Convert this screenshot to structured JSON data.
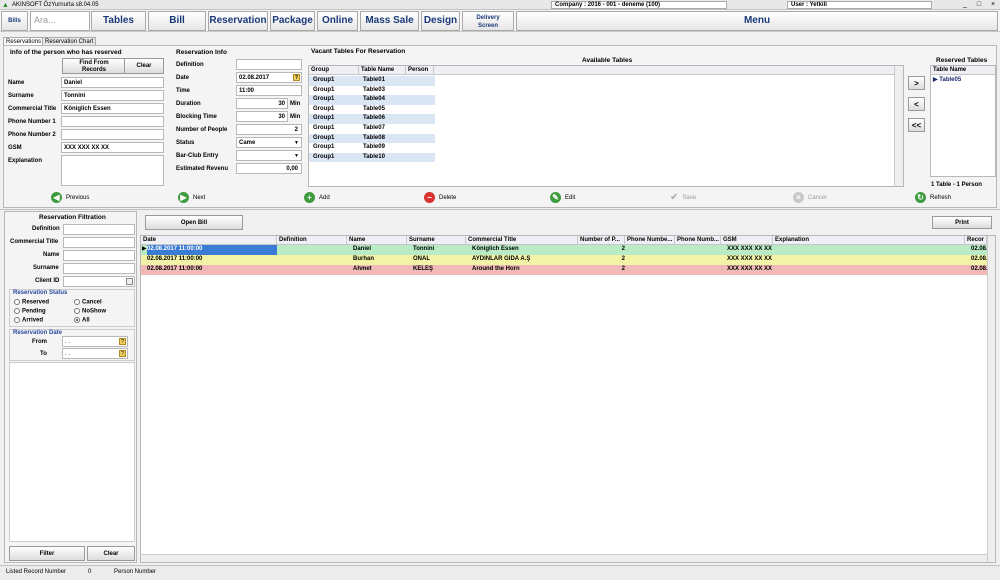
{
  "window": {
    "title": "AKINSOFT ÖzYurnurta  s8.04.05",
    "company": "Company : 2016 - 001 - deneme (100)",
    "user": "User : Yetkili",
    "controls": [
      "_",
      "□",
      "×"
    ]
  },
  "menu": {
    "bills": "Bills",
    "search_placeholder": "Ara...",
    "items": [
      "Tables",
      "Bill",
      "Reservation",
      "Package",
      "Online",
      "Mass Sale",
      "Design"
    ],
    "delivery_line1": "Delivery",
    "delivery_line2": "Screen",
    "menu": "Menu"
  },
  "tabs": [
    "Reservations",
    "Reservation Chart"
  ],
  "person": {
    "title": "Info of the person who has reserved",
    "find_line1": "Find From",
    "find_line2": "Records",
    "clear": "Clear",
    "labels": [
      "Name",
      "Surname",
      "Commercial Title",
      "Phone Number 1",
      "Phone Number 2",
      "GSM",
      "Explanation"
    ],
    "values": [
      "Daniel",
      "Tonnini",
      "Königlich Essen",
      "",
      "",
      "XXX XXX XX XX",
      ""
    ]
  },
  "resinfo": {
    "title": "Reservation Info",
    "labels": [
      "Definition",
      "Date",
      "Time",
      "Duration",
      "Blocking Time",
      "Number of People",
      "Status",
      "Bar-Club Entry",
      "Estimated Revenu"
    ],
    "values": [
      "",
      "02.08.2017",
      "11:00",
      "30",
      "30",
      "2",
      "Came",
      "",
      "0,00"
    ],
    "unit": "Min"
  },
  "vacant": {
    "title": "Vacant Tables For Reservation",
    "available_title": "Available Tables",
    "columns": [
      "Group",
      "Table Name",
      "Person"
    ],
    "rows": [
      [
        "Group1",
        "Table01"
      ],
      [
        "Group1",
        "Table03"
      ],
      [
        "Group1",
        "Table04"
      ],
      [
        "Group1",
        "Table05"
      ],
      [
        "Group1",
        "Table06"
      ],
      [
        "Group1",
        "Table07"
      ],
      [
        "Group1",
        "Table08"
      ],
      [
        "Group1",
        "Table09"
      ],
      [
        "Group1",
        "Table10"
      ]
    ],
    "move_buttons": [
      ">",
      "<",
      "<<"
    ]
  },
  "reserved": {
    "title": "Reserved Tables",
    "column": "Table Name",
    "rows": [
      "Table05"
    ],
    "summary": "1 Table - 1 Person"
  },
  "actions": [
    "Previous",
    "Next",
    "Add",
    "Delete",
    "Edit",
    "Save",
    "Cancel",
    "Refresh"
  ],
  "filter": {
    "title": "Reservation Filtration",
    "labels": [
      "Definition",
      "Commercial Title",
      "Name",
      "Surname",
      "Client ID"
    ],
    "status_title": "Reservation Status",
    "status_options": [
      "Reserved",
      "Cancel",
      "Pending",
      "NoShow",
      "Arrived",
      "All"
    ],
    "date_title": "Reservation Date",
    "from": "From",
    "to": "To",
    "date_placeholder": " .  .",
    "filter_btn": "Filter",
    "clear_btn": "Clear"
  },
  "list": {
    "open_bill": "Open Bill",
    "print": "Print",
    "columns": [
      "Date",
      "Definition",
      "Name",
      "Surname",
      "Commercial Title",
      "Number of P...",
      "Phone Numbe...",
      "Phone Numb...",
      "GSM",
      "Explanation",
      "Recor"
    ],
    "rows": [
      [
        "02.08.2017 11:00:00",
        "",
        "Daniel",
        "Tonnini",
        "Königlich Essen",
        "2",
        "",
        "",
        "XXX XXX XX XX",
        "",
        "02.08."
      ],
      [
        "02.08.2017 11:00:00",
        "",
        "Burhan",
        "ÖNAL",
        "AYDINLAR GIDA A.Ş",
        "2",
        "",
        "",
        "XXX XXX XX XX",
        "",
        "02.08."
      ],
      [
        "02.08.2017 11:00:00",
        "",
        "Ahmet",
        "KELEŞ",
        "Around the Horn",
        "2",
        "",
        "",
        "XXX XXX XX XX",
        "",
        "02.08."
      ]
    ],
    "row_colors": [
      "#b9ecc4",
      "#f3f3a8",
      "#f2b9b9"
    ]
  },
  "statusbar": {
    "listed_label": "Listed Record Number",
    "listed_value": "0",
    "person_label": "Person Number"
  }
}
